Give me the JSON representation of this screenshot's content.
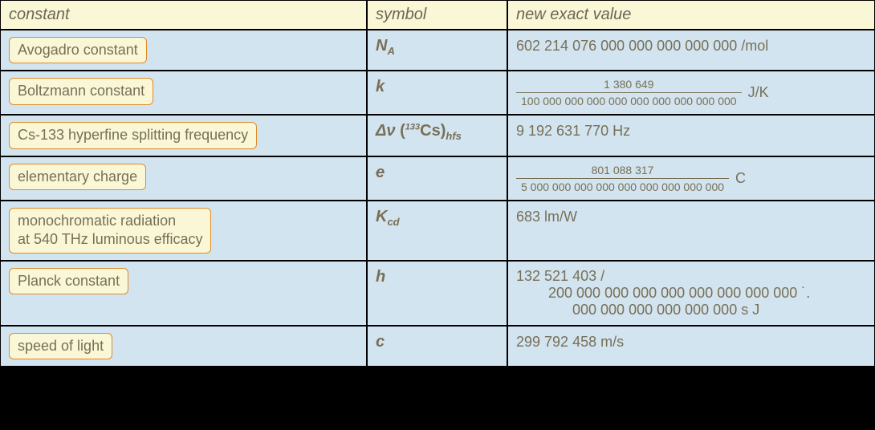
{
  "headers": {
    "constant": "constant",
    "symbol": "symbol",
    "value": "new exact value"
  },
  "rows": {
    "avogadro": {
      "name": "Avogadro constant",
      "symbol_base": "N",
      "symbol_sub": "A",
      "value": "602 214 076 000 000 000 000 000 /mol"
    },
    "boltzmann": {
      "name": "Boltzmann constant",
      "symbol": "k",
      "frac_num": "1 380 649",
      "frac_den": "100 000 000 000 000 000 000 000 000 000",
      "unit": "J/K"
    },
    "cs133": {
      "name": "Cs-133 hyperfine splitting frequency",
      "symbol_delta": "Δν",
      "symbol_isotope_sup": "133",
      "symbol_isotope": "Cs",
      "symbol_sub": "hfs",
      "value": "9 192 631 770 Hz"
    },
    "charge": {
      "name": "elementary charge",
      "symbol": "e",
      "frac_num": "801 088 317",
      "frac_den": "5 000 000 000 000 000 000 000 000 000",
      "unit": "C"
    },
    "kcd": {
      "name_l1": "monochromatic radiation",
      "name_l2": "at 540 THz luminous efficacy",
      "symbol_base": "K",
      "symbol_sub": "cd",
      "value": "683 lm/W"
    },
    "planck": {
      "name": "Planck constant",
      "symbol": "h",
      "line1": "132 521 403 /",
      "line2": "200 000 000 000 000 000 000 000 000 ˙.",
      "line3": "000 000 000 000 000 000 s J"
    },
    "light": {
      "name": "speed of light",
      "symbol": "c",
      "value": "299 792 458 m/s"
    }
  }
}
